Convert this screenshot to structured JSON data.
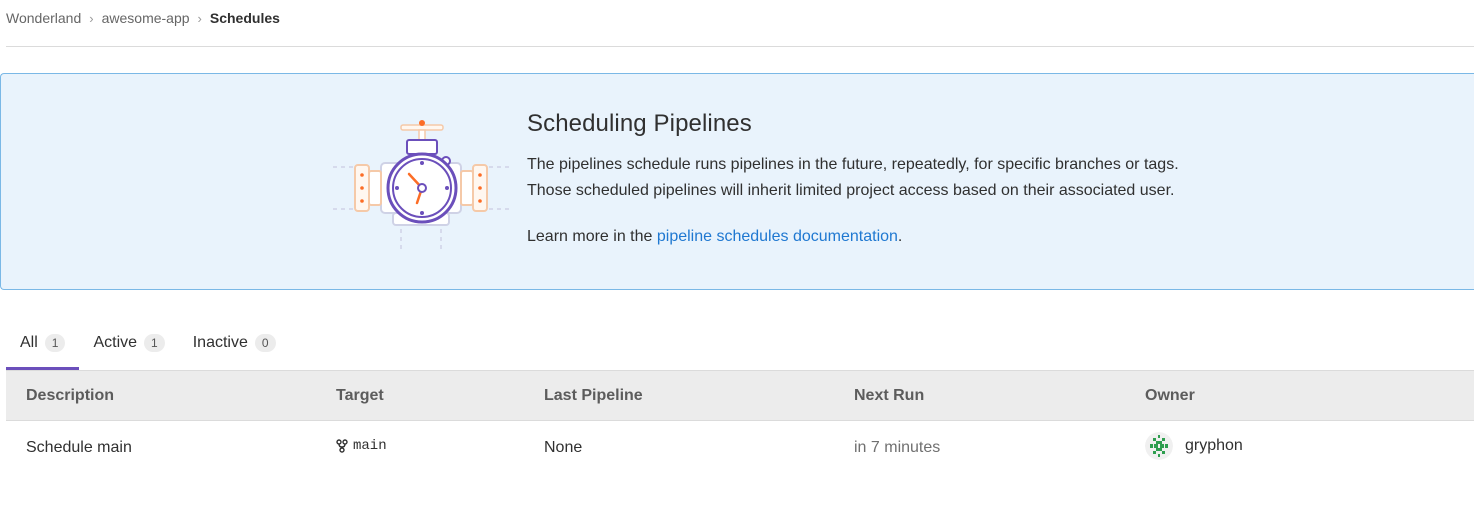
{
  "breadcrumb": {
    "items": [
      "Wonderland",
      "awesome-app"
    ],
    "current": "Schedules"
  },
  "callout": {
    "title": "Scheduling Pipelines",
    "line1": "The pipelines schedule runs pipelines in the future, repeatedly, for specific branches or tags.",
    "line2": "Those scheduled pipelines will inherit limited project access based on their associated user.",
    "learn_prefix": "Learn more in the ",
    "learn_link": "pipeline schedules documentation",
    "learn_suffix": "."
  },
  "tabs": [
    {
      "label": "All",
      "count": "1",
      "active": true
    },
    {
      "label": "Active",
      "count": "1",
      "active": false
    },
    {
      "label": "Inactive",
      "count": "0",
      "active": false
    }
  ],
  "table": {
    "headers": [
      "Description",
      "Target",
      "Last Pipeline",
      "Next Run",
      "Owner"
    ],
    "rows": [
      {
        "description": "Schedule main",
        "target": "main",
        "last_pipeline": "None",
        "next_run": "in 7 minutes",
        "owner": "gryphon"
      }
    ]
  },
  "icons": {
    "breadcrumb_separator": "chevron-right-icon",
    "branch": "fork-icon",
    "illustration": "pipeline-valve-clock-illustration"
  },
  "colors": {
    "accent": "#6b4fbb",
    "link": "#1f78d1",
    "callout_bg": "#e9f3fc",
    "callout_border": "#7ab8e6"
  }
}
